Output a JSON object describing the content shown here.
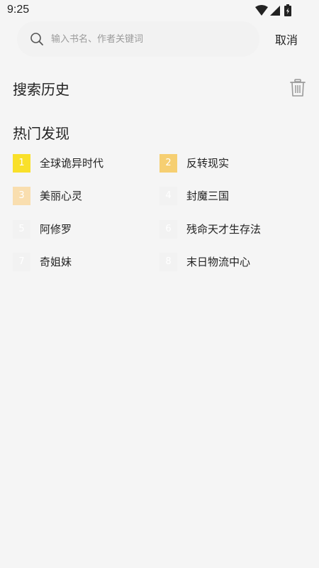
{
  "status_bar": {
    "time": "9:25",
    "icons": [
      "wifi-icon",
      "signal-icon",
      "battery-icon"
    ]
  },
  "search": {
    "placeholder": "输入书名、作者关键词",
    "value": "",
    "cancel_label": "取消"
  },
  "history": {
    "title": "搜索历史",
    "clear_icon": "trash-icon"
  },
  "hot": {
    "title": "热门发现",
    "items": [
      {
        "rank": "1",
        "title": "全球诡异时代",
        "badge_color": "#f9e02a"
      },
      {
        "rank": "2",
        "title": "反转现实",
        "badge_color": "#f6cf72"
      },
      {
        "rank": "3",
        "title": "美丽心灵",
        "badge_color": "#f9deaf"
      },
      {
        "rank": "4",
        "title": "封魔三国",
        "badge_color": "#f2f2f2"
      },
      {
        "rank": "5",
        "title": "阿修罗",
        "badge_color": "#f2f2f2"
      },
      {
        "rank": "6",
        "title": "残命天才生存法",
        "badge_color": "#f2f2f2"
      },
      {
        "rank": "7",
        "title": "奇姐妹",
        "badge_color": "#f2f2f2"
      },
      {
        "rank": "8",
        "title": "末日物流中心",
        "badge_color": "#f2f2f2"
      }
    ]
  },
  "colors": {
    "background": "#f5f5f5",
    "search_bar": "#f2f2f2",
    "text": "#222222",
    "placeholder": "#9b9b9b",
    "icon": "#9a9a9a"
  }
}
